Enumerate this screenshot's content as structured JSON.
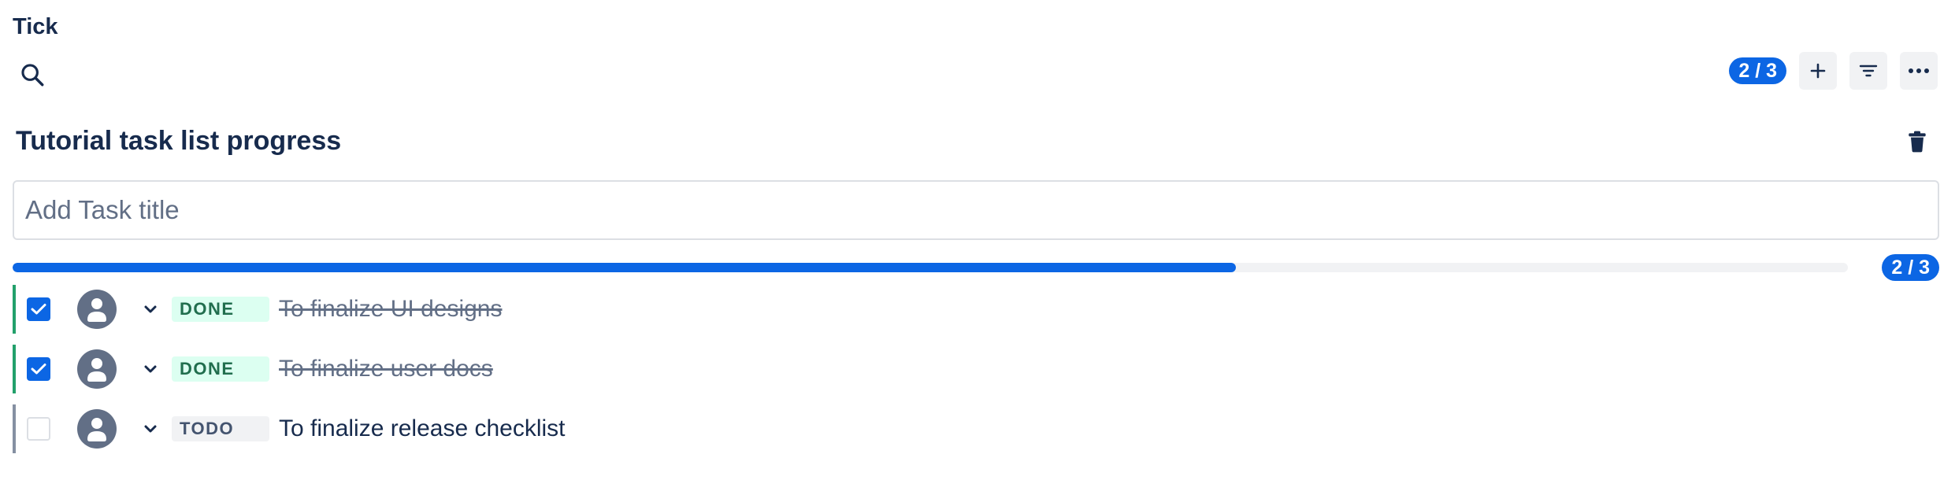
{
  "app": {
    "title": "Tick"
  },
  "toolbar": {
    "count": "2 / 3",
    "add_icon": "plus-icon",
    "filter_icon": "filter-icon",
    "more_icon": "more-icon"
  },
  "list": {
    "title": "Tutorial task list progress",
    "delete_icon": "trash-icon"
  },
  "input": {
    "placeholder": "Add Task title",
    "value": ""
  },
  "progress": {
    "label": "2 / 3",
    "fraction": 0.6667
  },
  "tasks": [
    {
      "checked": true,
      "status": "DONE",
      "title": "To finalize UI designs"
    },
    {
      "checked": true,
      "status": "DONE",
      "title": "To finalize user docs"
    },
    {
      "checked": false,
      "status": "TODO",
      "title": "To finalize release checklist"
    }
  ],
  "colors": {
    "accent": "#0c66e4",
    "done_border": "#22a06b",
    "todo_border": "#8590a2",
    "done_lozenge_bg": "#dcfff1",
    "done_lozenge_text": "#216e4e",
    "todo_lozenge_bg": "#f1f2f4",
    "todo_lozenge_text": "#44546f"
  }
}
